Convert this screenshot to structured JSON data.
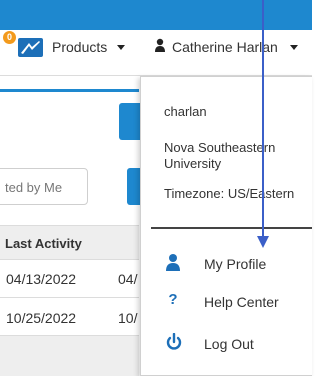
{
  "navbar": {
    "notification_badge": "0",
    "products_label": "Products",
    "user_name": "Catherine Harlan"
  },
  "background_page": {
    "search_input_partial": "ted by Me",
    "table": {
      "column_header": "Last Activity",
      "rows": [
        {
          "last_activity": "04/13/2022",
          "next_col_partial": "04/"
        },
        {
          "last_activity": "10/25/2022",
          "next_col_partial": "10/"
        }
      ]
    }
  },
  "user_dropdown": {
    "username": "charlan",
    "organization": "Nova Southeastern University",
    "timezone": "Timezone: US/Eastern",
    "items": [
      {
        "label": "My Profile",
        "icon": "user-icon"
      },
      {
        "label": "Help Center",
        "icon": "question-mark-icon"
      },
      {
        "label": "Log Out",
        "icon": "power-icon"
      }
    ]
  },
  "colors": {
    "accent": "#1e88cf",
    "icon_blue": "#1d6fb8",
    "badge_orange": "#f39a1c"
  }
}
